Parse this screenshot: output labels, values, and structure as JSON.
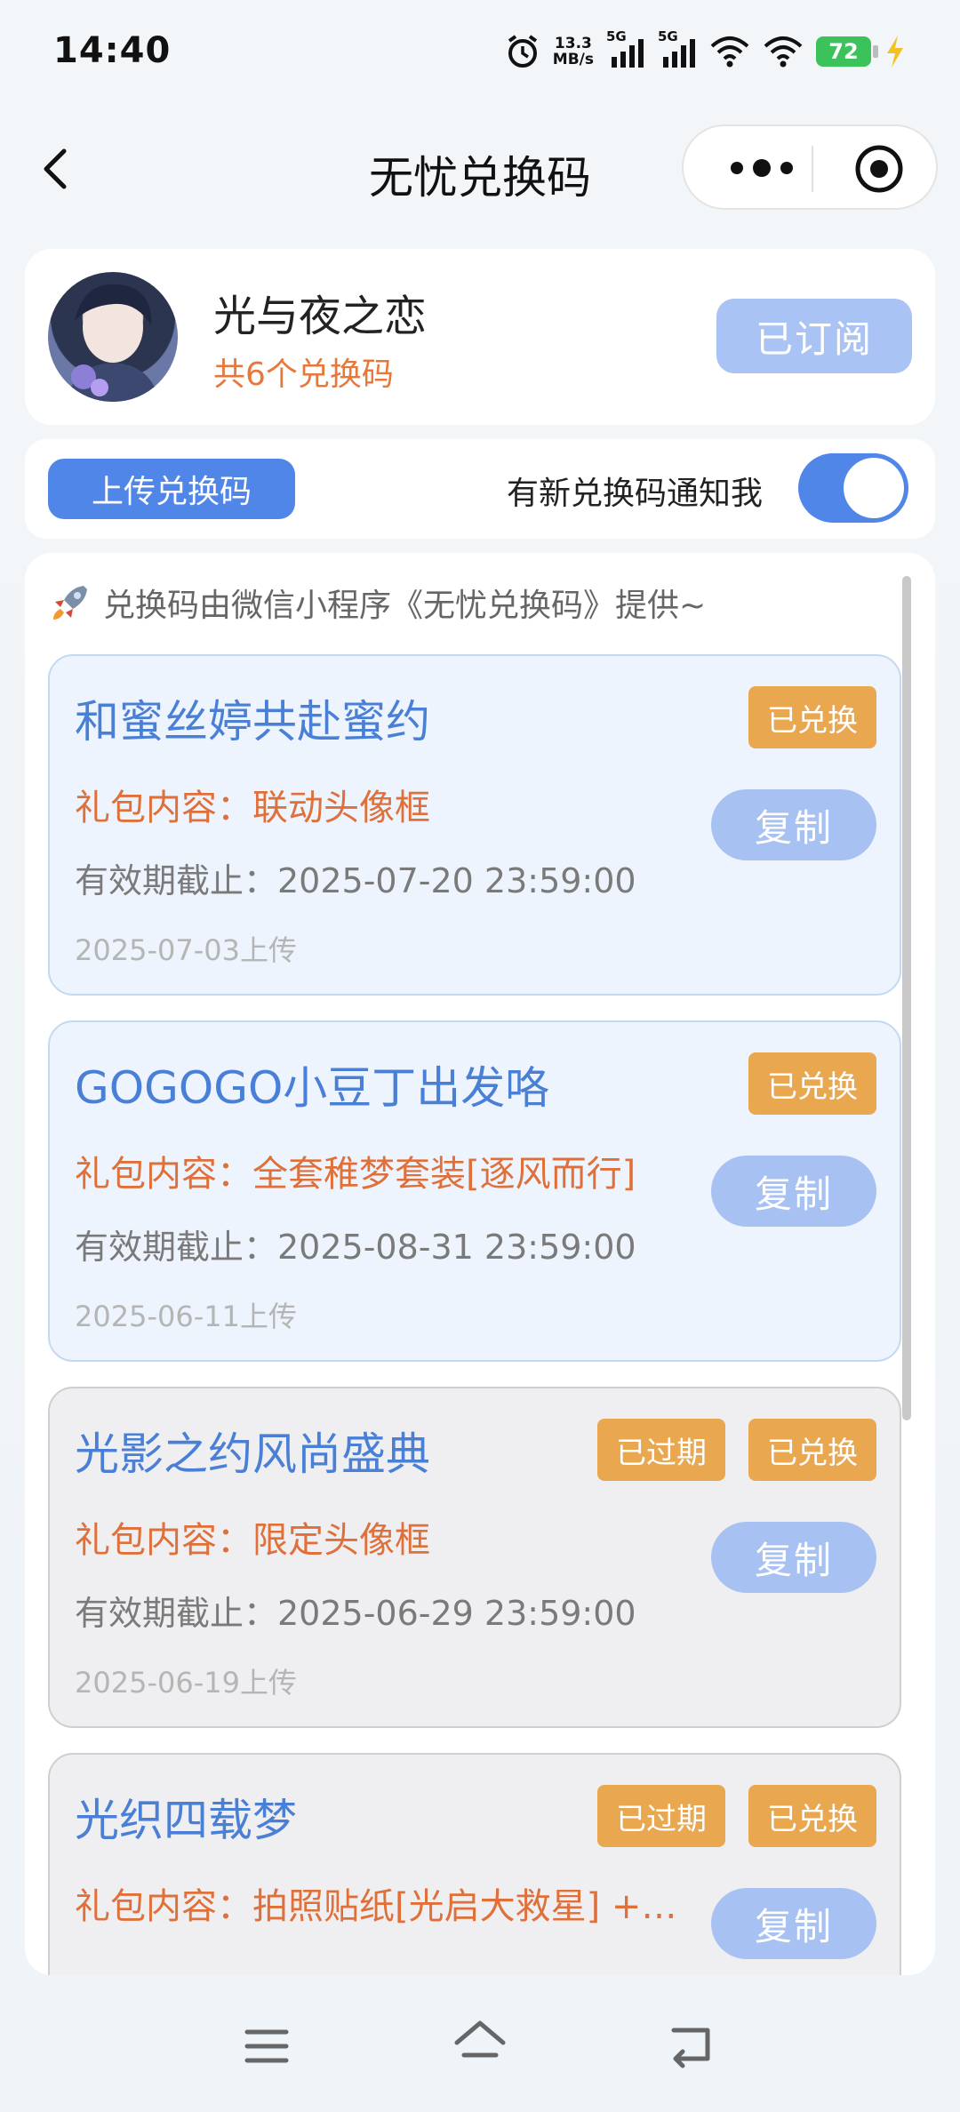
{
  "status_bar": {
    "time": "14:40",
    "net_speed_value": "13.3",
    "net_speed_unit": "MB/s",
    "signal_label_1": "5G",
    "signal_label_2": "5G",
    "battery": "72"
  },
  "nav": {
    "title": "无忧兑换码"
  },
  "profile": {
    "game_name": "光与夜之恋",
    "code_count": "共6个兑换码",
    "subscribe_label": "已订阅"
  },
  "actions": {
    "upload_label": "上传兑换码",
    "notify_label": "有新兑换码通知我",
    "notify_enabled": true
  },
  "codes": {
    "provider_note": "兑换码由微信小程序《无忧兑换码》提供~",
    "copy_label": "复制",
    "tag_redeemed": "已兑换",
    "tag_expired": "已过期",
    "items": [
      {
        "title": "和蜜丝婷共赴蜜约",
        "gift": "礼包内容：联动头像框",
        "deadline": "有效期截止：2025-07-20 23:59:00",
        "uploaded": "2025-07-03上传",
        "expired": false,
        "redeemed": true
      },
      {
        "title": "GOGOGO小豆丁出发咯",
        "gift": "礼包内容：全套稚梦套装[逐风而行]",
        "deadline": "有效期截止：2025-08-31 23:59:00",
        "uploaded": "2025-06-11上传",
        "expired": false,
        "redeemed": true
      },
      {
        "title": "光影之约风尚盛典",
        "gift": "礼包内容：限定头像框",
        "deadline": "有效期截止：2025-06-29 23:59:00",
        "uploaded": "2025-06-19上传",
        "expired": true,
        "redeemed": true
      },
      {
        "title": "光织四载梦",
        "gift": "礼包内容：拍照贴纸[光启大救星] +…",
        "deadline": "",
        "uploaded": "",
        "expired": true,
        "redeemed": true
      }
    ]
  },
  "colors": {
    "accent_blue": "#4f86e8",
    "tag_orange": "#e9a850",
    "gift_orange": "#e0703a",
    "title_blue": "#4a7fd6"
  }
}
